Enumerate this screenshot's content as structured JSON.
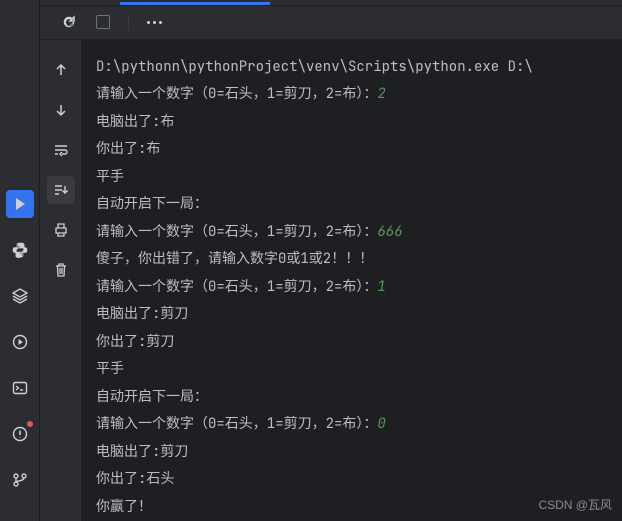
{
  "toolbar": {
    "rerun_title": "Rerun",
    "stop_title": "Stop",
    "more_title": "More"
  },
  "gutter": {
    "up_title": "Up the Stack Trace",
    "down_title": "Down the Stack Trace",
    "wrap_title": "Soft-Wrap",
    "scroll_title": "Scroll to End",
    "print_title": "Print",
    "clear_title": "Clear All"
  },
  "rail": {
    "run_title": "Run",
    "python_title": "Python Console",
    "structure_title": "Structure",
    "services_title": "Services",
    "terminal_title": "Terminal",
    "problems_title": "Problems",
    "vcs_title": "Version Control"
  },
  "console": {
    "line0": "D:\\pythonn\\pythonProject\\venv\\Scripts\\python.exe D:\\",
    "prompt": "请输入一个数字（0=石头，1=剪刀，2=布）：",
    "input1": "2",
    "comp_prefix": "电脑出了:",
    "user_prefix": "你出了:",
    "comp1": "布",
    "user1": "布",
    "tie": "平手",
    "next_round": "自动开启下一局：",
    "input2": "666",
    "error": "傻子，你出错了，请输入数字0或1或2！！！",
    "input3": "1",
    "comp3": "剪刀",
    "user3": "剪刀",
    "input4": "0",
    "comp4": "剪刀",
    "user4": "石头",
    "win": "你赢了！"
  },
  "watermark": "CSDN @瓦风"
}
